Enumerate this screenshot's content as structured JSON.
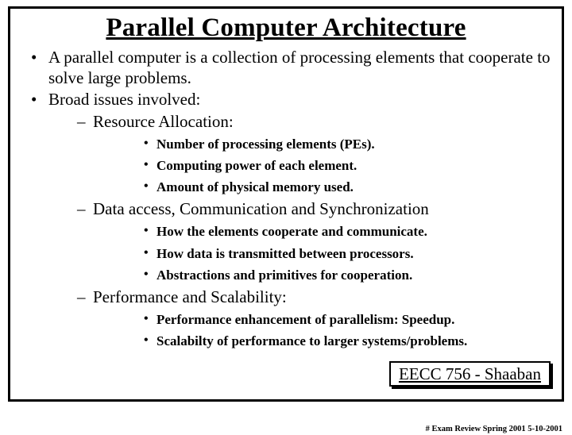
{
  "title": "Parallel Computer Architecture",
  "bullets": {
    "b1": "A parallel computer is a collection of processing elements that cooperate to solve large problems.",
    "b2": "Broad issues involved:",
    "s1": "Resource Allocation:",
    "s1a": "Number of processing elements (PEs).",
    "s1b": "Computing power of each element.",
    "s1c": "Amount of physical memory used.",
    "s2": "Data access, Communication and Synchronization",
    "s2a": "How the elements  cooperate and communicate.",
    "s2b": "How data is transmitted between processors.",
    "s2c": "Abstractions and primitives for cooperation.",
    "s3": "Performance and Scalability:",
    "s3a": "Performance enhancement of parallelism:  Speedup.",
    "s3b": "Scalabilty of performance to larger systems/problems."
  },
  "footer": {
    "main": "EECC 756 - Shaaban",
    "sub": "#   Exam Review   Spring 2001  5-10-2001"
  }
}
